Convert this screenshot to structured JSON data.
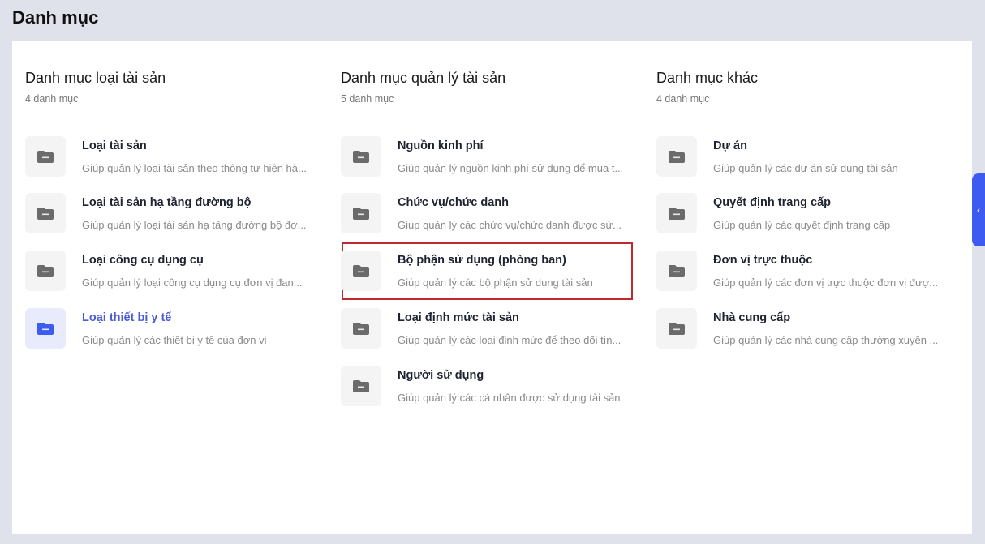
{
  "page": {
    "title": "Danh mục"
  },
  "colors": {
    "accent": "#3d5af1",
    "active_text": "#4a5bd4",
    "highlight": "#c0282d"
  },
  "columns": [
    {
      "title": "Danh mục loại tài sản",
      "count": "4 danh mục",
      "items": [
        {
          "title": "Loại tài sản",
          "desc": "Giúp quản lý loại tài sản theo thông tư hiện hà..."
        },
        {
          "title": "Loại tài sản hạ tầng đường bộ",
          "desc": "Giúp quản lý loại tài sản hạ tầng đường bộ đơ..."
        },
        {
          "title": "Loại công cụ dụng cụ",
          "desc": "Giúp quản lý loại công cụ dụng cụ đơn vị đan..."
        },
        {
          "title": "Loại thiết bị y tế",
          "desc": "Giúp quản lý các thiết bị y tế của đơn vị",
          "active": true
        }
      ]
    },
    {
      "title": "Danh mục quản lý tài sản",
      "count": "5 danh mục",
      "items": [
        {
          "title": "Nguồn kinh phí",
          "desc": "Giúp quản lý nguồn kinh phí sử dụng để mua t..."
        },
        {
          "title": "Chức vụ/chức danh",
          "desc": "Giúp quản lý các chức vụ/chức danh được sử..."
        },
        {
          "title": "Bộ phận sử dụng (phòng ban)",
          "desc": "Giúp quản lý các bộ phận sử dụng tài sản",
          "highlighted": true
        },
        {
          "title": "Loại định mức tài sản",
          "desc": "Giúp quản lý các loại định mức để theo dõi tìn..."
        },
        {
          "title": "Người sử dụng",
          "desc": "Giúp quản lý các cá nhân được sử dụng tài sản"
        }
      ]
    },
    {
      "title": "Danh mục khác",
      "count": "4 danh mục",
      "items": [
        {
          "title": "Dự án",
          "desc": "Giúp quản lý các dự án sử dụng tài sản"
        },
        {
          "title": "Quyết định trang cấp",
          "desc": "Giúp quản lý các quyết định trang cấp"
        },
        {
          "title": "Đơn vị trực thuộc",
          "desc": "Giúp quản lý các đơn vị trực thuộc đơn vị đượ..."
        },
        {
          "title": "Nhà cung cấp",
          "desc": "Giúp quản lý các nhà cung cấp thường xuyên ..."
        }
      ]
    }
  ],
  "side_tab": {
    "icon": "chevron-left-icon",
    "glyph": "‹"
  }
}
